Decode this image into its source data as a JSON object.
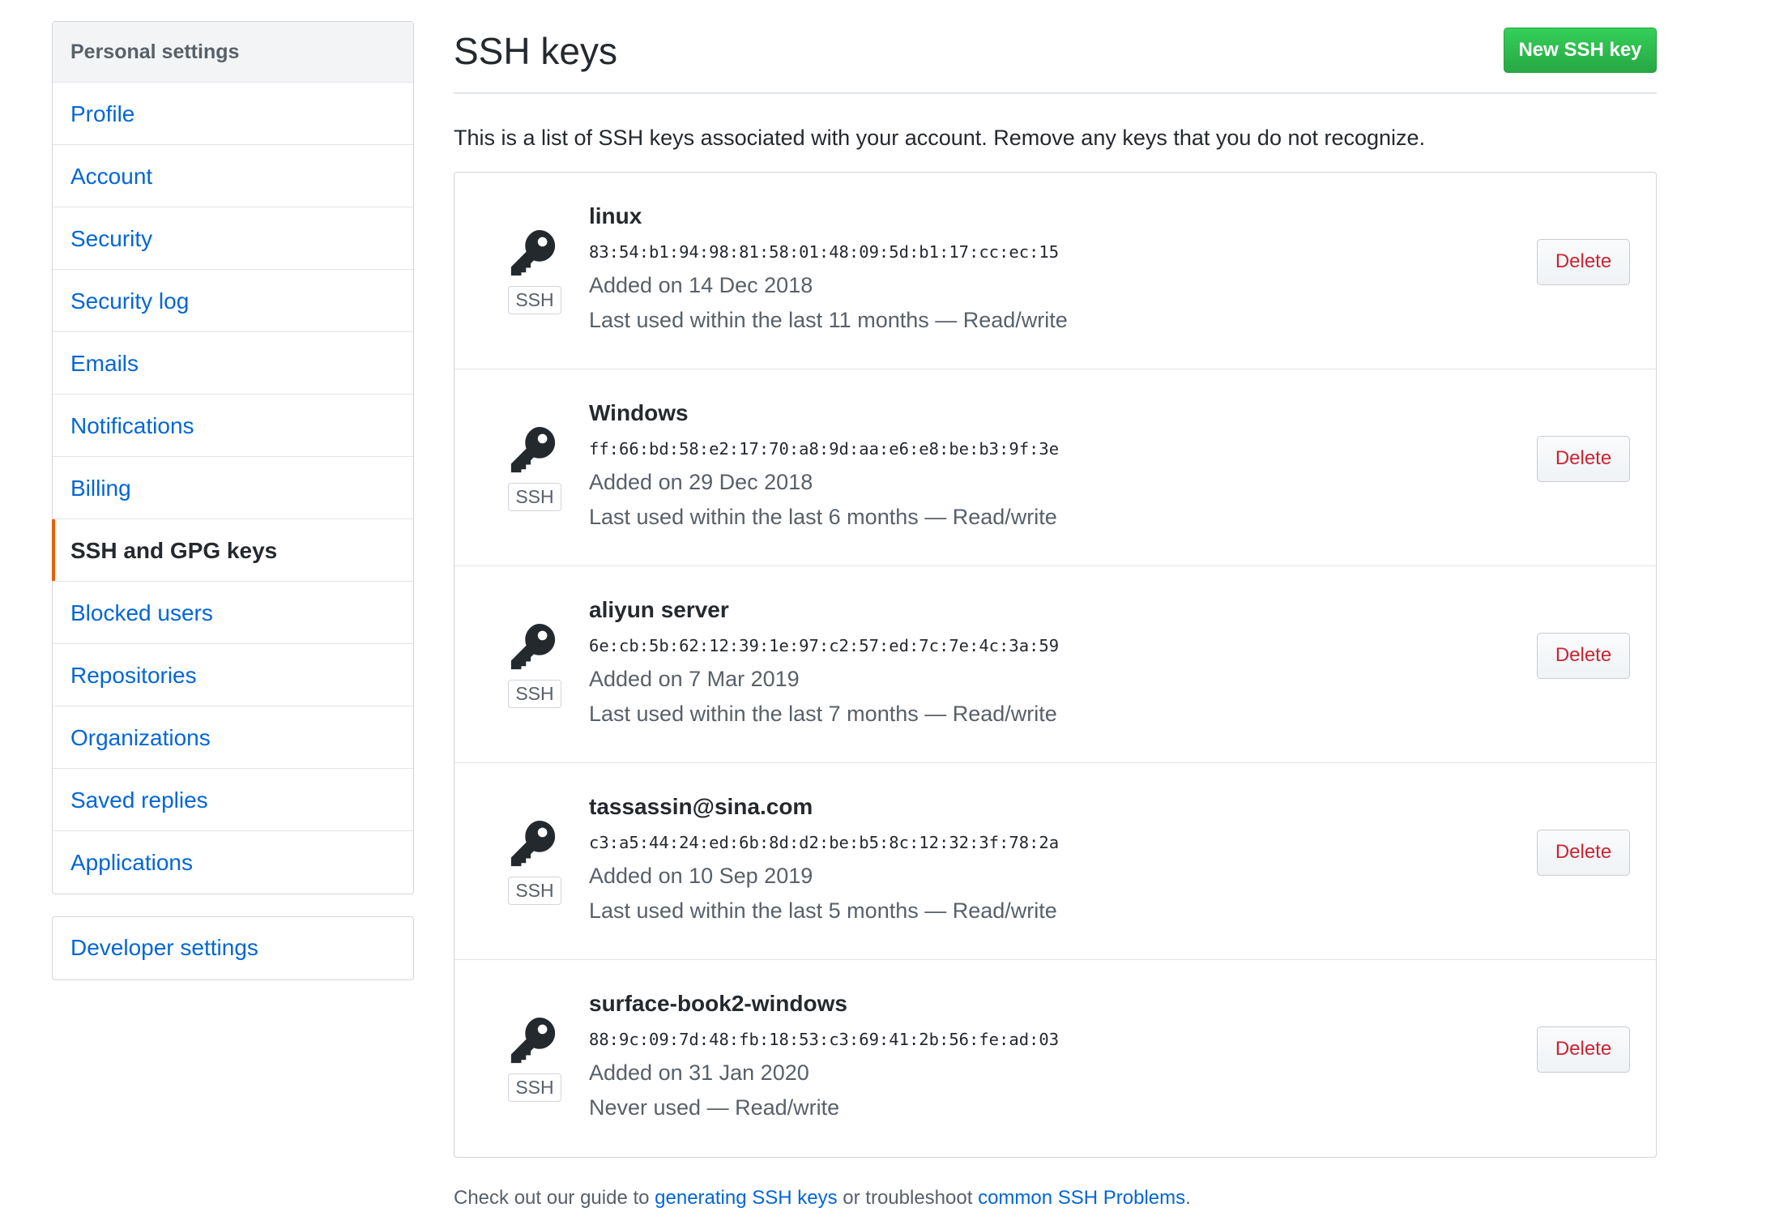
{
  "sidebar": {
    "heading": "Personal settings",
    "items": [
      {
        "label": "Profile"
      },
      {
        "label": "Account"
      },
      {
        "label": "Security"
      },
      {
        "label": "Security log"
      },
      {
        "label": "Emails"
      },
      {
        "label": "Notifications"
      },
      {
        "label": "Billing"
      },
      {
        "label": "SSH and GPG keys",
        "selected": true
      },
      {
        "label": "Blocked users"
      },
      {
        "label": "Repositories"
      },
      {
        "label": "Organizations"
      },
      {
        "label": "Saved replies"
      },
      {
        "label": "Applications"
      }
    ],
    "developer": "Developer settings"
  },
  "header": {
    "title": "SSH keys",
    "new_key_label": "New SSH key"
  },
  "intro": "This is a list of SSH keys associated with your account. Remove any keys that you do not recognize.",
  "keys": [
    {
      "title": "linux",
      "fingerprint": "83:54:b1:94:98:81:58:01:48:09:5d:b1:17:cc:ec:15",
      "added": "Added on 14 Dec 2018",
      "used": "Last used within the last 11 months — Read/write",
      "badge": "SSH",
      "delete_label": "Delete"
    },
    {
      "title": "Windows",
      "fingerprint": "ff:66:bd:58:e2:17:70:a8:9d:aa:e6:e8:be:b3:9f:3e",
      "added": "Added on 29 Dec 2018",
      "used": "Last used within the last 6 months — Read/write",
      "badge": "SSH",
      "delete_label": "Delete"
    },
    {
      "title": "aliyun server",
      "fingerprint": "6e:cb:5b:62:12:39:1e:97:c2:57:ed:7c:7e:4c:3a:59",
      "added": "Added on 7 Mar 2019",
      "used": "Last used within the last 7 months — Read/write",
      "badge": "SSH",
      "delete_label": "Delete"
    },
    {
      "title": "tassassin@sina.com",
      "fingerprint": "c3:a5:44:24:ed:6b:8d:d2:be:b5:8c:12:32:3f:78:2a",
      "added": "Added on 10 Sep 2019",
      "used": "Last used within the last 5 months — Read/write",
      "badge": "SSH",
      "delete_label": "Delete"
    },
    {
      "title": "surface-book2-windows",
      "fingerprint": "88:9c:09:7d:48:fb:18:53:c3:69:41:2b:56:fe:ad:03",
      "added": "Added on 31 Jan 2020",
      "used": "Never used — Read/write",
      "badge": "SSH",
      "delete_label": "Delete"
    }
  ],
  "help": {
    "prefix": "Check out our guide to ",
    "link1": "generating SSH keys",
    "middle": " or troubleshoot ",
    "link2": "common SSH Problems",
    "suffix": "."
  },
  "icons": {
    "key": "key-icon"
  },
  "colors": {
    "link": "#0366d6",
    "selected_marker": "#e36209",
    "primary_button": "#28a745",
    "danger_text": "#cb2431"
  }
}
